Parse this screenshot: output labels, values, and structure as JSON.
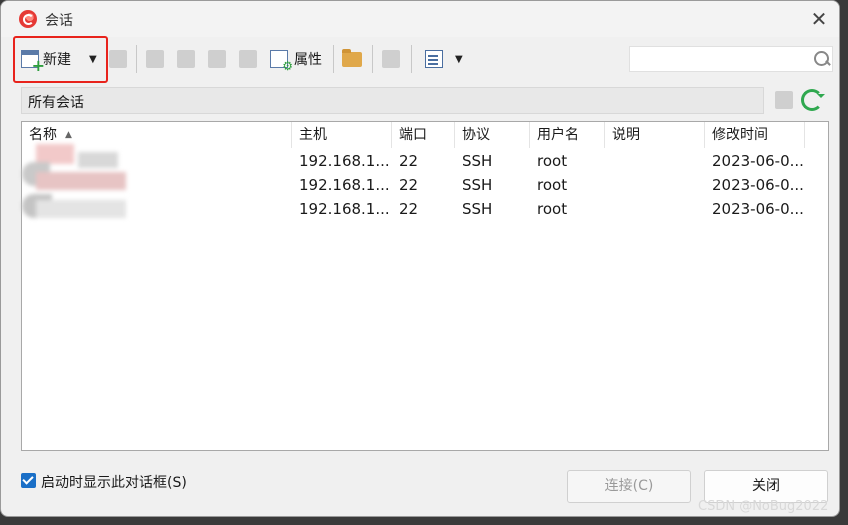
{
  "window": {
    "title": "会话",
    "close_glyph": "✕"
  },
  "toolbar": {
    "new_label": "新建",
    "properties_label": "属性",
    "dropdown_glyph": "▼",
    "icons": [
      "new-session-icon",
      "find-icon",
      "cut-icon",
      "copy-icon",
      "paste-icon",
      "delete-icon",
      "properties-icon",
      "folder-icon",
      "shortcut-icon",
      "view-icon"
    ]
  },
  "search": {
    "value": "",
    "placeholder": ""
  },
  "path_bar": {
    "text": "所有会话"
  },
  "table": {
    "columns": [
      "名称",
      "主机",
      "端口",
      "协议",
      "用户名",
      "说明",
      "修改时间"
    ],
    "rows": [
      {
        "name": "",
        "host": "192.168.1...",
        "port": "22",
        "protocol": "SSH",
        "user": "root",
        "desc": "",
        "modified": "2023-06-0..."
      },
      {
        "name": "",
        "host": "192.168.1...",
        "port": "22",
        "protocol": "SSH",
        "user": "root",
        "desc": "",
        "modified": "2023-06-0..."
      },
      {
        "name": "",
        "host": "192.168.1...",
        "port": "22",
        "protocol": "SSH",
        "user": "root",
        "desc": "",
        "modified": "2023-06-0..."
      }
    ]
  },
  "footer": {
    "startup_checkbox_label": "启动时显示此对话框(S)",
    "startup_checked": true,
    "connect_label": "连接(C)",
    "close_label": "关闭"
  },
  "watermark": "CSDN @NoBug2022",
  "colors": {
    "highlight": "#e8231c",
    "accent": "#1a6fc7",
    "refresh": "#2fa84f"
  }
}
